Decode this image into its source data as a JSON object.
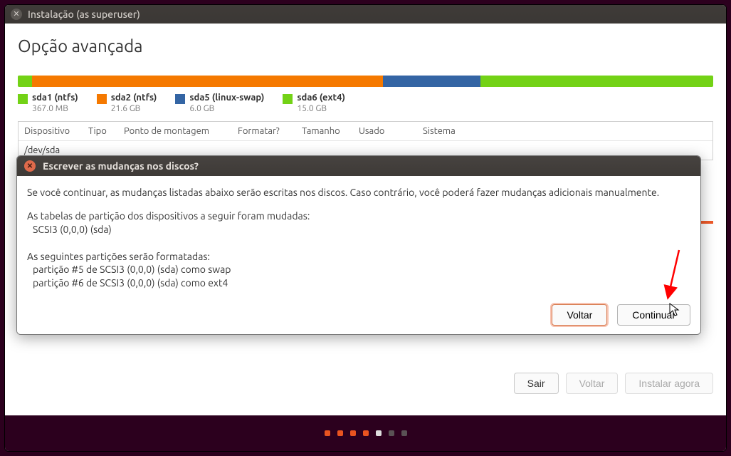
{
  "window": {
    "title": "Instalação (as superuser)"
  },
  "page": {
    "title": "Opção avançada",
    "drive_prefix": "D"
  },
  "partitions": {
    "items": [
      {
        "name": "sda1 (ntfs)",
        "size": "367.0 MB",
        "color": "green"
      },
      {
        "name": "sda2 (ntfs)",
        "size": "21.6 GB",
        "color": "orange"
      },
      {
        "name": "sda5 (linux-swap)",
        "size": "6.0 GB",
        "color": "blue"
      },
      {
        "name": "sda6 (ext4)",
        "size": "15.0 GB",
        "color": "green"
      }
    ]
  },
  "table": {
    "headers": {
      "device": "Dispositivo",
      "type": "Tipo",
      "mount": "Ponto de montagem",
      "format": "Formatar?",
      "size": "Tamanho",
      "used": "Usado",
      "system": "Sistema"
    },
    "row0": "/dev/sda"
  },
  "footer": {
    "quit": "Sair",
    "back": "Voltar",
    "install": "Instalar agora"
  },
  "dialog": {
    "title": "Escrever as mudanças nos discos?",
    "line1": "Se você continuar, as mudanças listadas abaixo serão escritas nos discos. Caso contrário, você poderá fazer mudanças adicionais manualmente.",
    "line2": "As tabelas de partição dos dispositivos a seguir foram mudadas:",
    "line2a": "SCSI3 (0,0,0) (sda)",
    "line3": "As seguintes partições serão formatadas:",
    "line3a": "partição #5 de SCSI3 (0,0,0) (sda) como swap",
    "line3b": "partição #6 de SCSI3 (0,0,0) (sda) como ext4",
    "back": "Voltar",
    "continue": "Continuar"
  }
}
